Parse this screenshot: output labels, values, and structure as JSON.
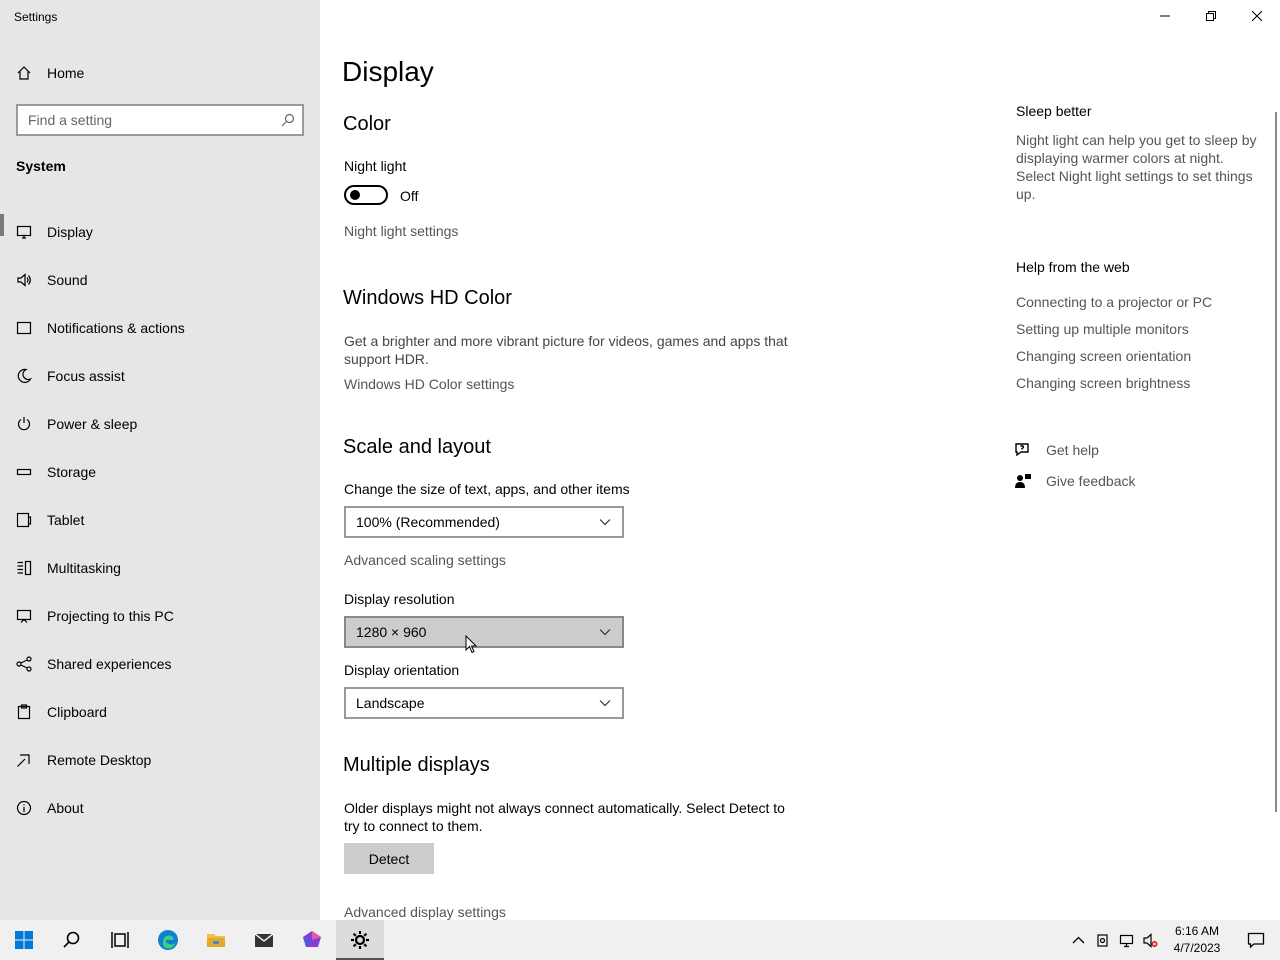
{
  "window": {
    "title": "Settings"
  },
  "sidebar": {
    "home_label": "Home",
    "search_placeholder": "Find a setting",
    "section_title": "System",
    "items": [
      {
        "label": "Display",
        "icon": "monitor-icon",
        "selected": true
      },
      {
        "label": "Sound",
        "icon": "speaker-icon"
      },
      {
        "label": "Notifications & actions",
        "icon": "notification-icon"
      },
      {
        "label": "Focus assist",
        "icon": "moon-icon"
      },
      {
        "label": "Power & sleep",
        "icon": "power-icon"
      },
      {
        "label": "Storage",
        "icon": "storage-icon"
      },
      {
        "label": "Tablet",
        "icon": "tablet-icon"
      },
      {
        "label": "Multitasking",
        "icon": "multitasking-icon"
      },
      {
        "label": "Projecting to this PC",
        "icon": "projecting-icon"
      },
      {
        "label": "Shared experiences",
        "icon": "shared-icon"
      },
      {
        "label": "Clipboard",
        "icon": "clipboard-icon"
      },
      {
        "label": "Remote Desktop",
        "icon": "remote-desktop-icon"
      },
      {
        "label": "About",
        "icon": "info-icon"
      }
    ]
  },
  "main": {
    "title": "Display",
    "color": {
      "heading": "Color",
      "night_light_label": "Night light",
      "night_light_state": "Off",
      "night_light_link": "Night light settings"
    },
    "hdr": {
      "heading": "Windows HD Color",
      "description": "Get a brighter and more vibrant picture for videos, games and apps that support HDR.",
      "link": "Windows HD Color settings"
    },
    "scale": {
      "heading": "Scale and layout",
      "size_label": "Change the size of text, apps, and other items",
      "size_value": "100% (Recommended)",
      "advanced_link": "Advanced scaling settings",
      "resolution_label": "Display resolution",
      "resolution_value": "1280 × 960",
      "orientation_label": "Display orientation",
      "orientation_value": "Landscape"
    },
    "multiple": {
      "heading": "Multiple displays",
      "description": "Older displays might not always connect automatically. Select Detect to try to connect to them.",
      "detect_label": "Detect",
      "advanced_link": "Advanced display settings"
    }
  },
  "aside": {
    "sleep_title": "Sleep better",
    "sleep_desc": "Night light can help you get to sleep by displaying warmer colors at night. Select Night light settings to set things up.",
    "web_title": "Help from the web",
    "web_links": [
      "Connecting to a projector or PC",
      "Setting up multiple monitors",
      "Changing screen orientation",
      "Changing screen brightness"
    ],
    "get_help": "Get help",
    "give_feedback": "Give feedback"
  },
  "taskbar": {
    "time": "6:16 AM",
    "date": "4/7/2023"
  },
  "colors": {
    "sidebar_bg": "#e6e6e6",
    "accent": "#0078d7",
    "edge_blue": "#0f7fd6",
    "folder_yellow": "#f0c040"
  }
}
